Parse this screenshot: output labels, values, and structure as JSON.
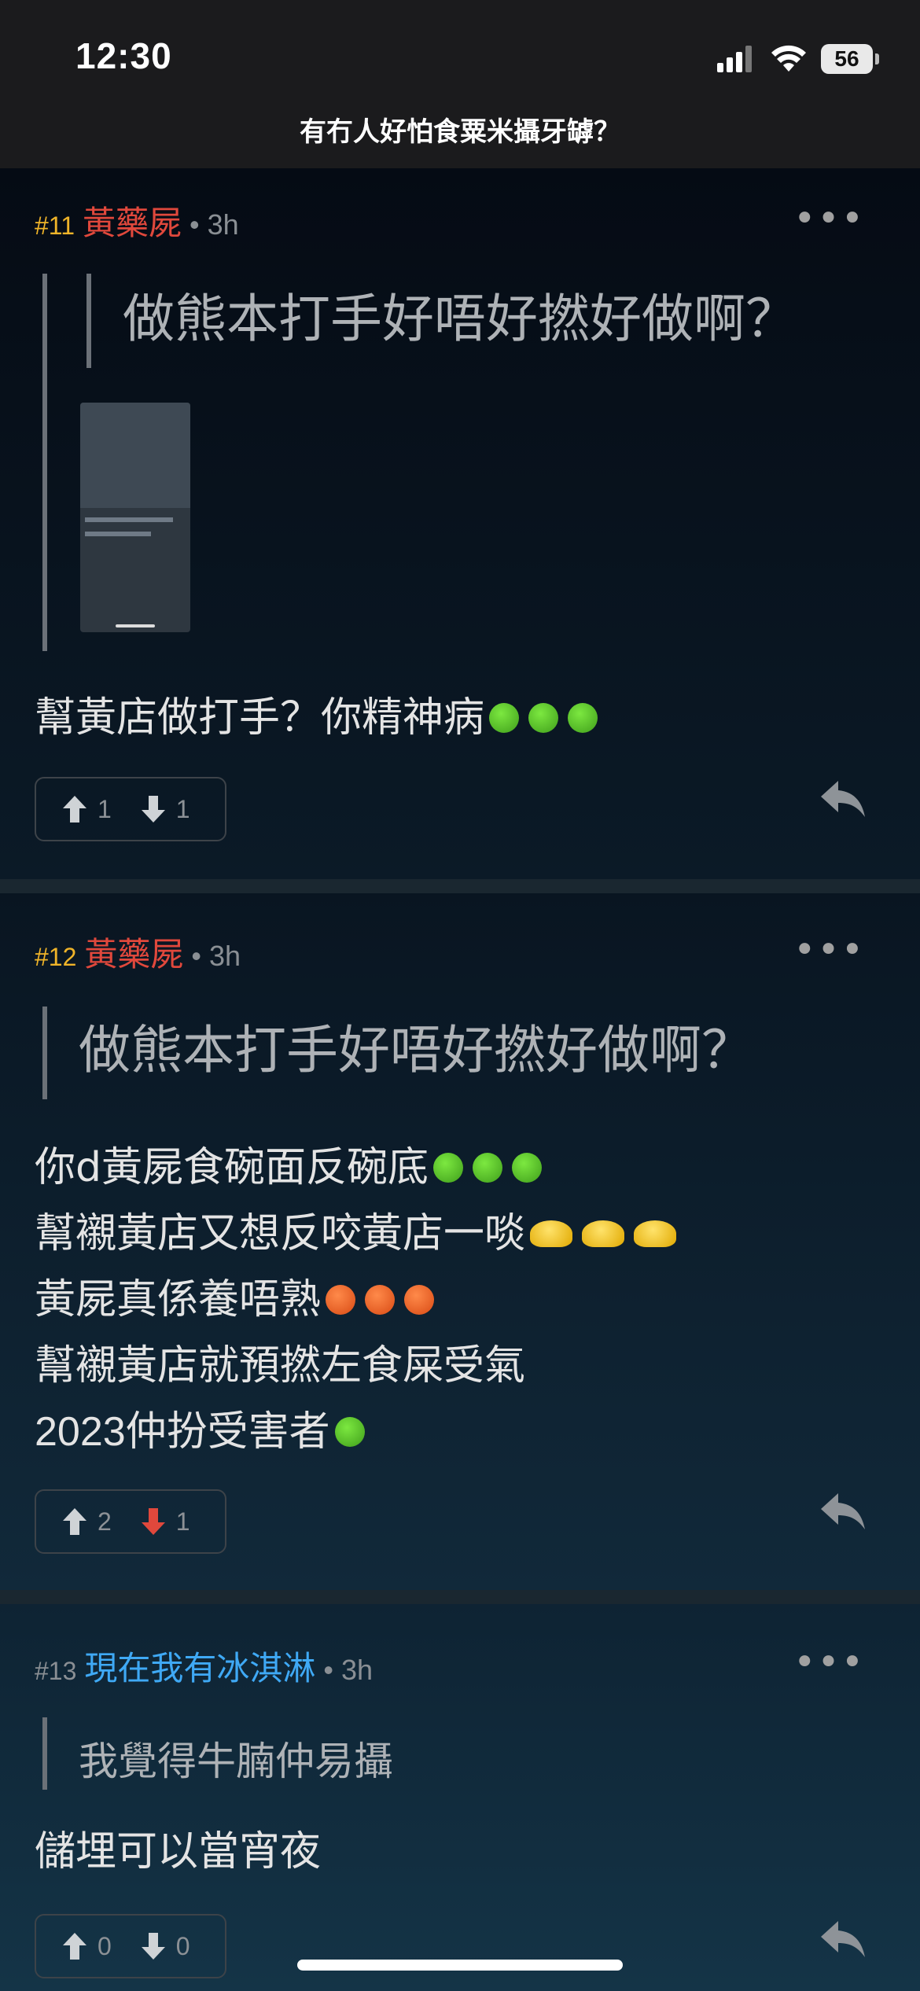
{
  "status_bar": {
    "time": "12:30",
    "battery": "56"
  },
  "header": {
    "title": "有冇人好怕食粟米攝牙罅？"
  },
  "posts": [
    {
      "floor": "#11",
      "author": "黃藥屍",
      "time": "3h",
      "author_color": "#e0483c",
      "floor_color": "#f0b429",
      "quote": "做熊本打手好唔好撚好做啊？",
      "body": [
        "幫黃店做打手？你精神病"
      ],
      "upvotes": "1",
      "downvotes": "1"
    },
    {
      "floor": "#12",
      "author": "黃藥屍",
      "time": "3h",
      "author_color": "#e0483c",
      "floor_color": "#f0b429",
      "quote": "做熊本打手好唔好撚好做啊？",
      "body": [
        "你d黃屍食碗面反碗底",
        "幫襯黃店又想反咬黃店一啖",
        "黃屍真係養唔熟",
        "幫襯黃店就預撚左食屎受氣",
        "2023仲扮受害者"
      ],
      "upvotes": "2",
      "downvotes": "1"
    },
    {
      "floor": "#13",
      "author": "現在我有冰淇淋",
      "time": "3h",
      "author_color": "#3fa9f5",
      "floor_color": "#8a8f94",
      "quote": "我覺得牛腩仲易攝",
      "body": [
        "儲埋可以當宵夜"
      ],
      "upvotes": "0",
      "downvotes": "0"
    }
  ],
  "icons": {
    "more": "more-horizontal-icon",
    "reply": "reply-arrow-icon",
    "up": "thumb-up-arrow-icon",
    "down": "thumb-down-arrow-icon"
  }
}
